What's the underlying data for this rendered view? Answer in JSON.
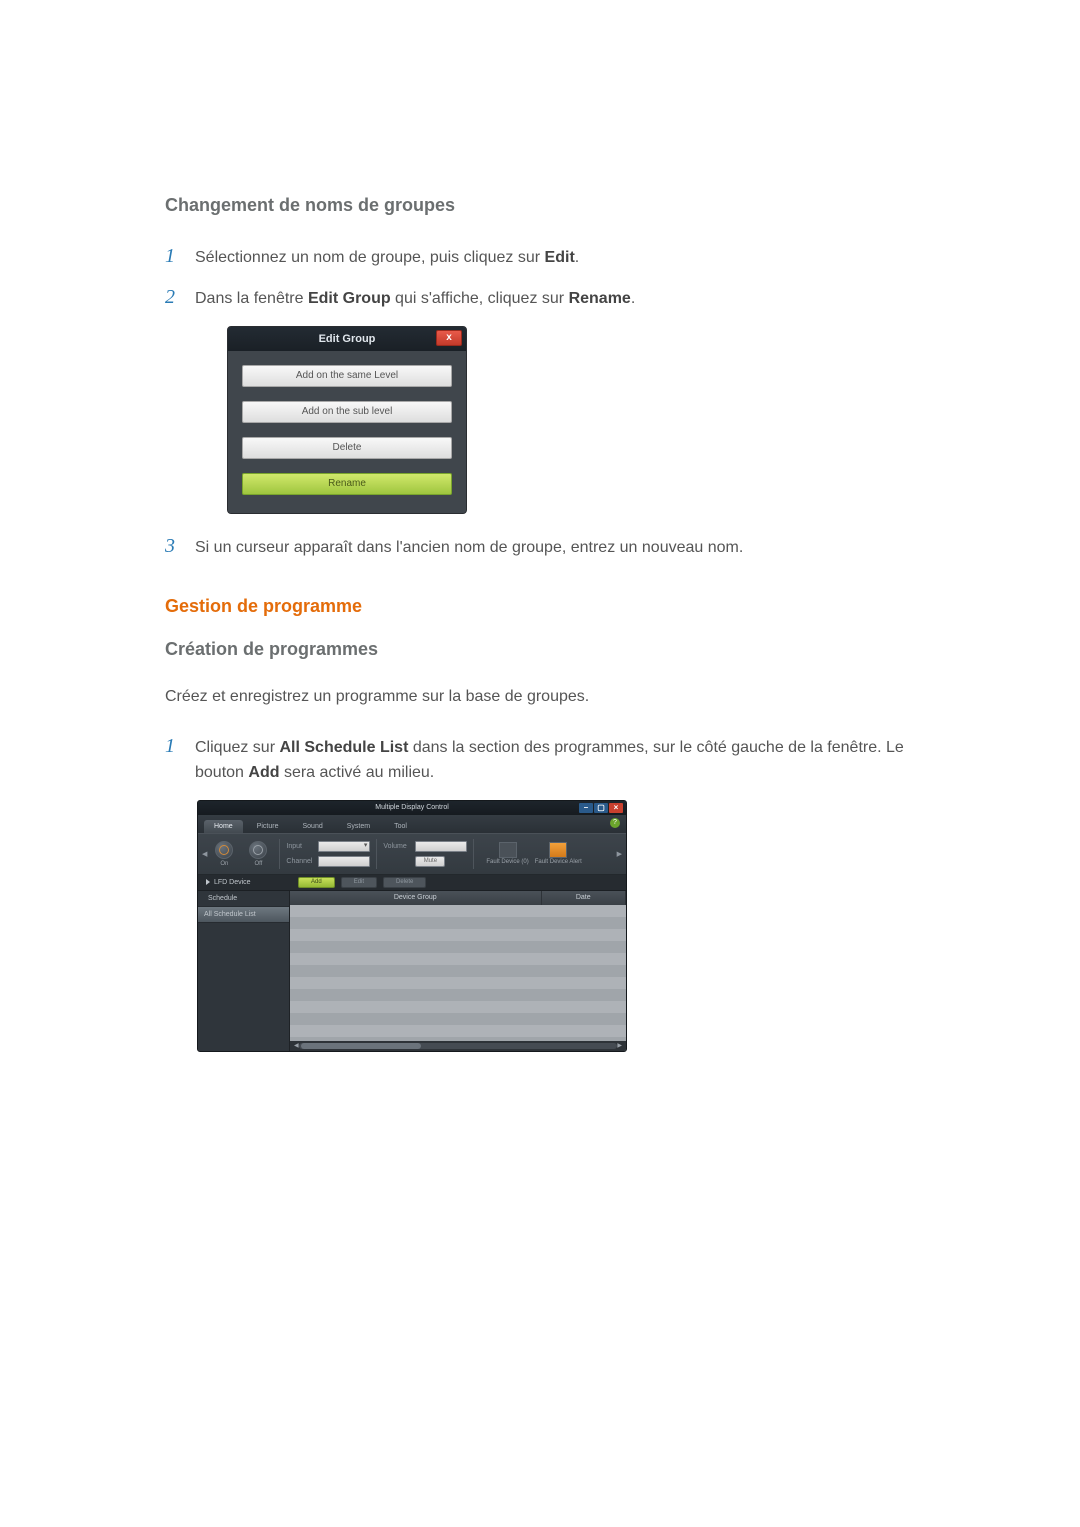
{
  "sec1": {
    "title": "Changement de noms de groupes",
    "step1_a": "Sélectionnez un nom de groupe, puis cliquez sur ",
    "step1_b": "Edit",
    "step1_c": ".",
    "step2_a": "Dans la fenêtre ",
    "step2_b": "Edit Group",
    "step2_c": " qui s'affiche, cliquez sur ",
    "step2_d": "Rename",
    "step2_e": ".",
    "step3": "Si un curseur apparaît dans l'ancien nom de groupe, entrez un nouveau nom."
  },
  "edit_group": {
    "title": "Edit Group",
    "close": "x",
    "b1": "Add on the same Level",
    "b2": "Add on the sub level",
    "b3": "Delete",
    "b4": "Rename"
  },
  "sec2": {
    "title": "Gestion de programme",
    "sub": "Création de programmes",
    "body": "Créez et enregistrez un programme sur la base de groupes.",
    "step1_a": "Cliquez sur ",
    "step1_b": "All Schedule List",
    "step1_c": " dans la section des programmes, sur le côté gauche de la fenêtre. Le bouton ",
    "step1_d": "Add",
    "step1_e": " sera activé au milieu."
  },
  "mdc": {
    "title": "Multiple Display Control",
    "tabs": {
      "home": "Home",
      "picture": "Picture",
      "sound": "Sound",
      "system": "System",
      "tool": "Tool"
    },
    "help": "?",
    "power": {
      "on": "On",
      "off": "Off"
    },
    "input_lbl": "Input",
    "channel_lbl": "Channel",
    "volume_lbl": "Volume",
    "mute_lbl": "Mute",
    "fault0": "Fault Device (0)",
    "fault_alert": "Fault Device Alert",
    "lfd": "LFD Device",
    "add": "Add",
    "edit": "Edit",
    "delete": "Delete",
    "schedule": "Schedule",
    "all_schedule": "All Schedule List",
    "col_group": "Device Group",
    "col_date": "Date"
  },
  "nums": {
    "1": "1",
    "2": "2",
    "3": "3"
  }
}
